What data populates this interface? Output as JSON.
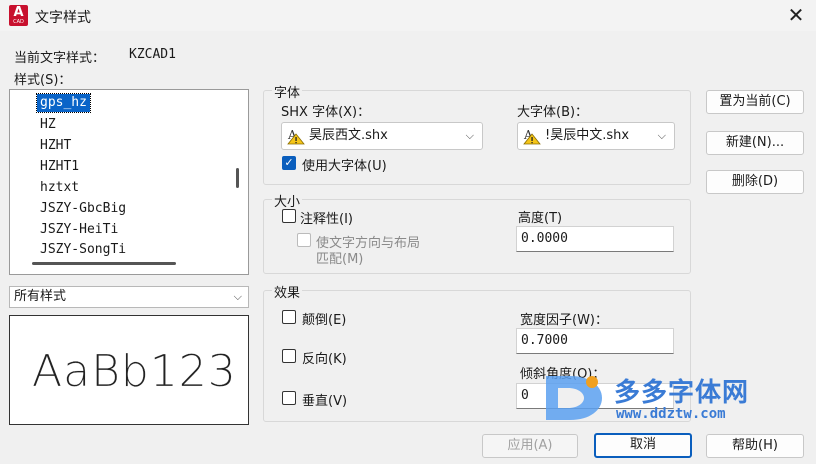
{
  "window": {
    "title": "文字样式",
    "logo_letter": "A",
    "logo_sub": "CAD",
    "close_glyph": "✕"
  },
  "current_style": {
    "label": "当前文字样式：",
    "value": "KZCAD1"
  },
  "styles": {
    "label": "样式(S)：",
    "items": [
      "gps_hz",
      "HZ",
      "HZHT",
      "HZHT1",
      "hztxt",
      "JSZY-GbcBig",
      "JSZY-HeiTi",
      "JSZY-SongTi"
    ],
    "selected_index": 0
  },
  "filter": {
    "selected": "所有样式",
    "chevron": "⌵"
  },
  "preview": {
    "text": "AaBb123"
  },
  "font": {
    "group_title": "字体",
    "shx_label": "SHX 字体(X)：",
    "shx_value": "昊辰西文.shx",
    "big_label": "大字体(B)：",
    "big_value": "!昊辰中文.shx",
    "use_big_font_label": "使用大字体(U)",
    "use_big_font_checked": true
  },
  "size": {
    "group_title": "大小",
    "annotative_label": "注释性(I)",
    "match_orientation_label_1": "使文字方向与布局",
    "match_orientation_label_2": "匹配(M)",
    "height_label": "高度(T)",
    "height_value": "0.0000"
  },
  "effects": {
    "group_title": "效果",
    "upside_down_label": "颠倒(E)",
    "backwards_label": "反向(K)",
    "vertical_label": "垂直(V)",
    "width_factor_label": "宽度因子(W)：",
    "width_factor_value": "0.7000",
    "oblique_label": "倾斜角度(O)：",
    "oblique_value": "0"
  },
  "buttons": {
    "set_current": "置为当前(C)",
    "new": "新建(N)...",
    "delete": "删除(D)",
    "apply": "应用(A)",
    "cancel": "取消",
    "help": "帮助(H)"
  },
  "watermark": {
    "title": "多多字体网",
    "url": "www.ddztw.com"
  },
  "colors": {
    "accent": "#0a5ebd",
    "selection": "#0a64c8",
    "brand_red": "#c8102e"
  }
}
